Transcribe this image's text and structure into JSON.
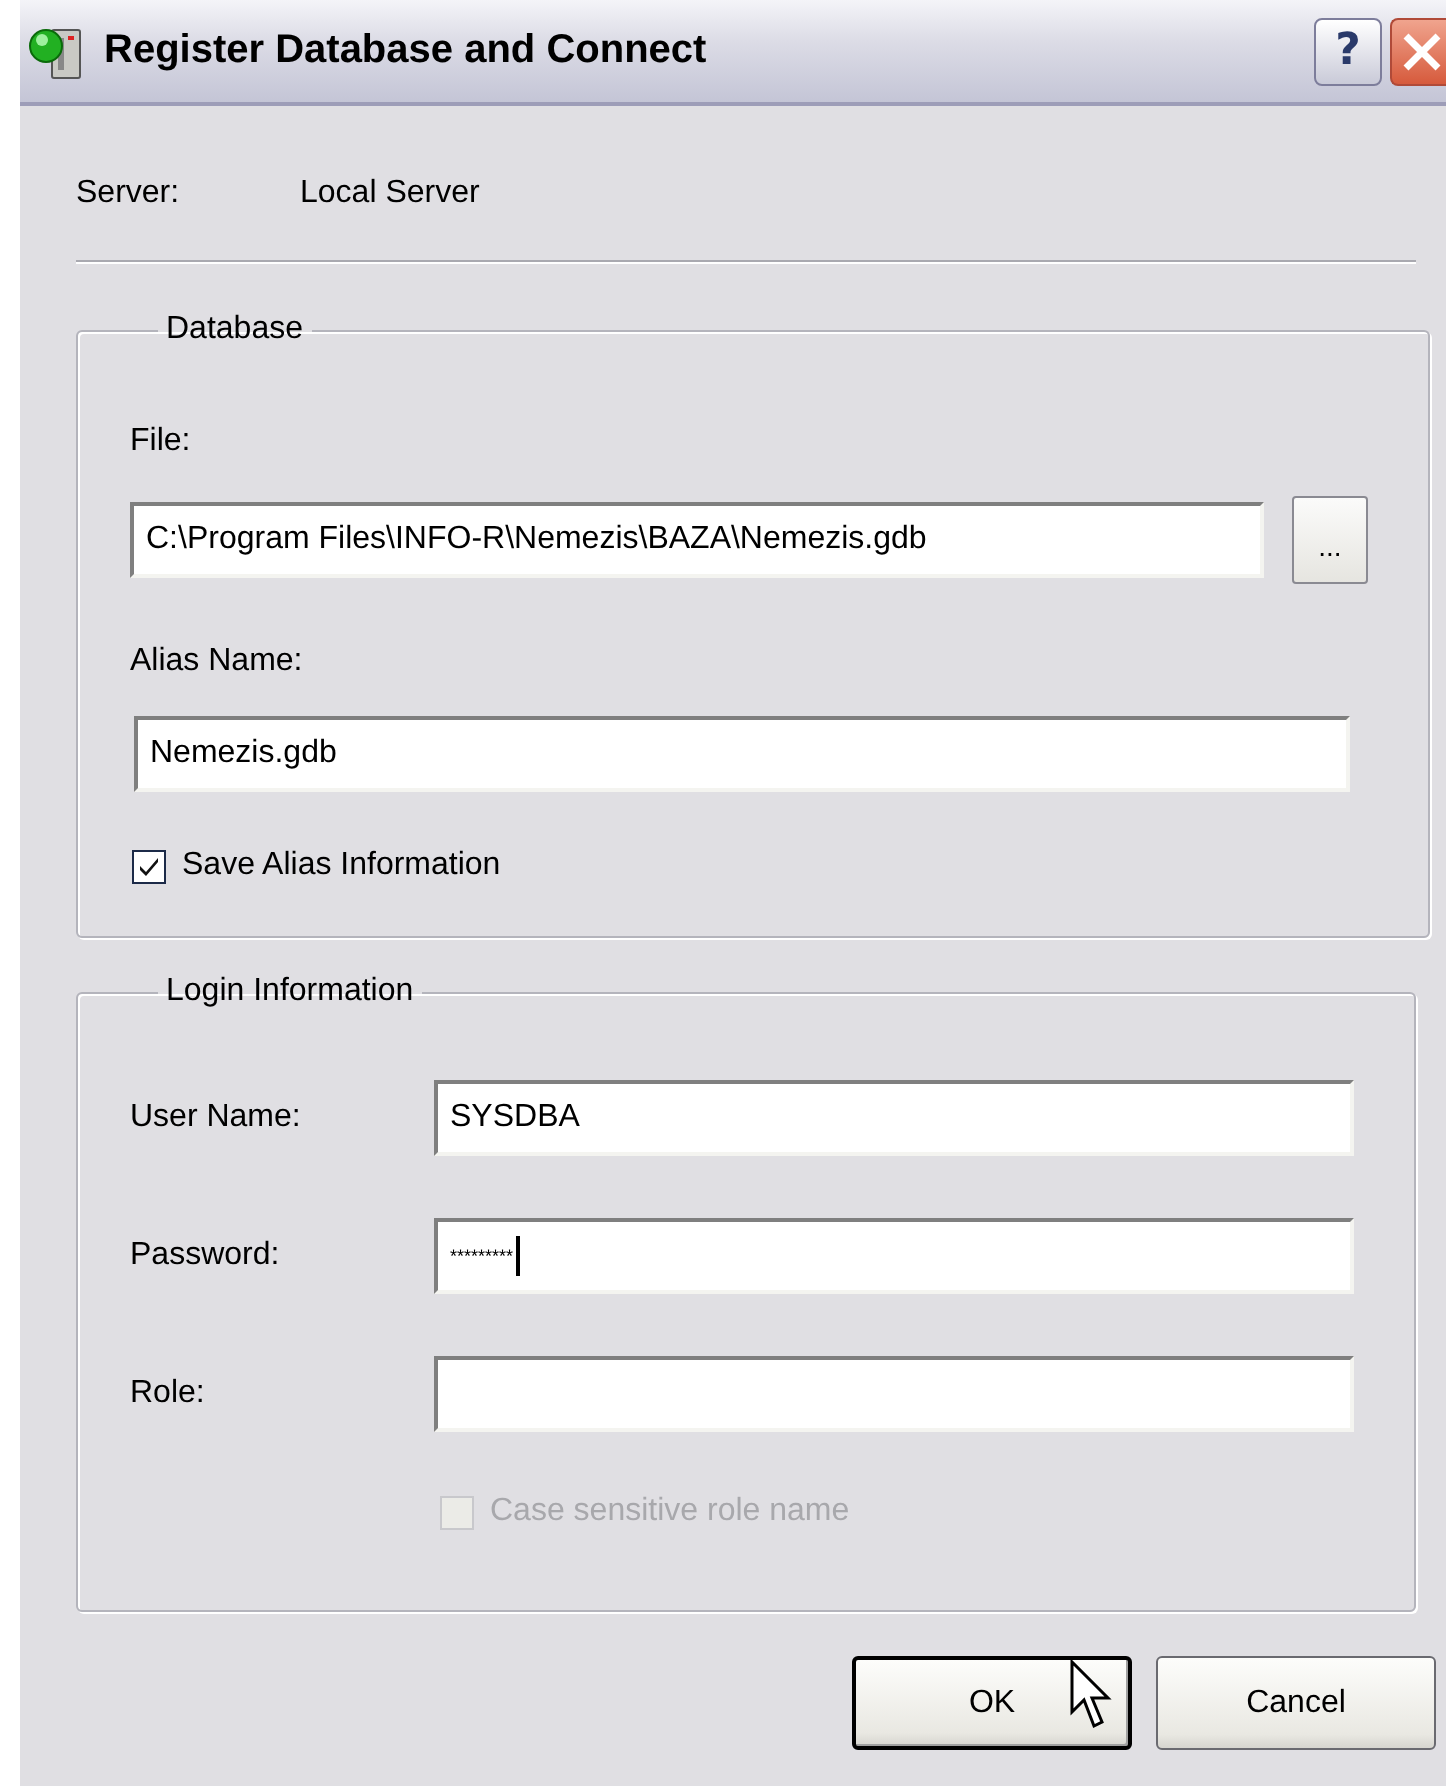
{
  "window": {
    "title": "Register Database and Connect",
    "help_button": "?"
  },
  "server": {
    "label": "Server:",
    "value": "Local Server"
  },
  "database": {
    "legend": "Database",
    "file": {
      "label": "File:",
      "value": "C:\\Program Files\\INFO-R\\Nemezis\\BAZA\\Nemezis.gdb",
      "browse": "..."
    },
    "alias": {
      "label": "Alias Name:",
      "value": "Nemezis.gdb"
    },
    "save_alias": {
      "label": "Save Alias Information",
      "checked": true,
      "disabled": false
    }
  },
  "login": {
    "legend": "Login Information",
    "fields": [
      {
        "label": "User Name:",
        "value": "SYSDBA",
        "kind": "text",
        "focused": false
      },
      {
        "label": "Password:",
        "value": "*********",
        "kind": "password",
        "focused": true
      },
      {
        "label": "Role:",
        "kind": "text",
        "focused": false
      }
    ],
    "case_sensitive": {
      "label": "Case sensitive role name",
      "checked": false,
      "disabled": true
    }
  },
  "buttons": [
    {
      "label": "OK",
      "default": true
    },
    {
      "label": "Cancel",
      "default": false
    }
  ]
}
